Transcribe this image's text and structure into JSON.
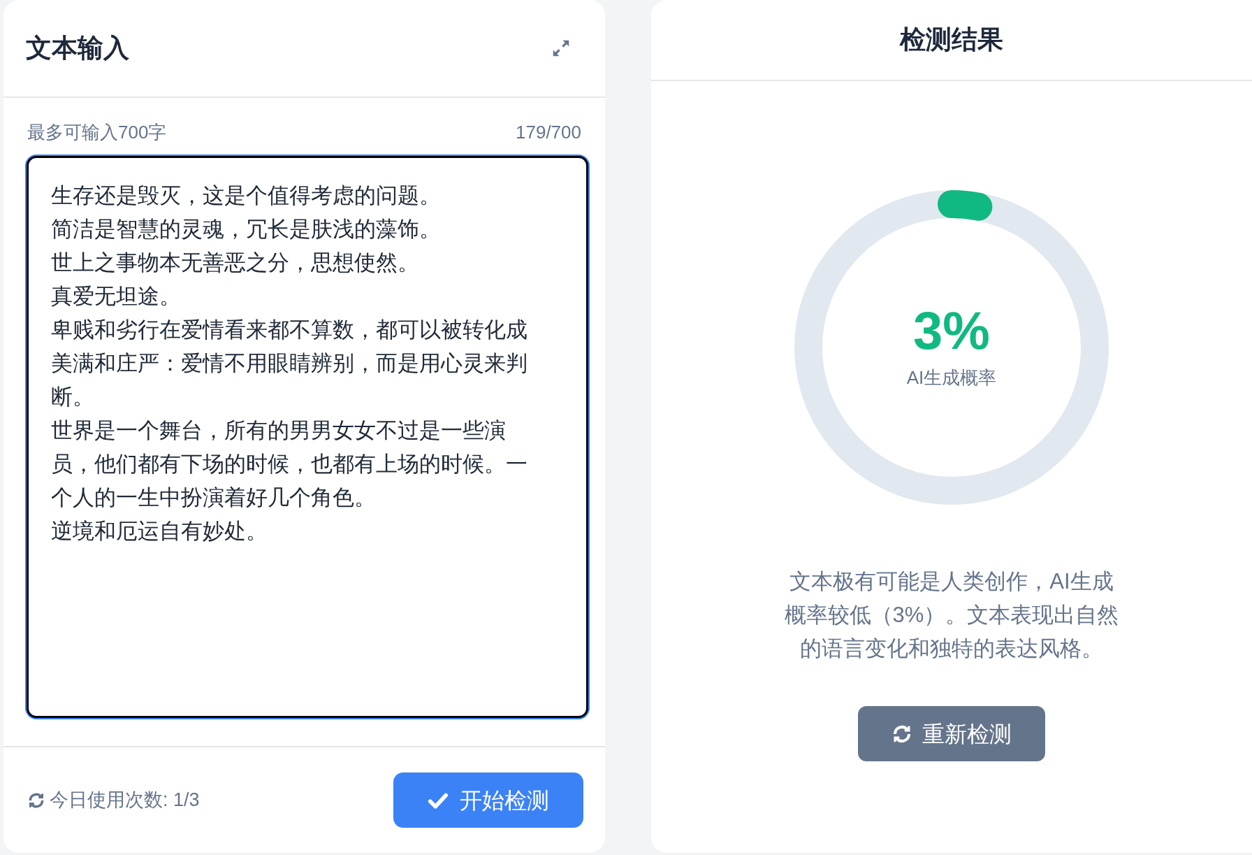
{
  "input_panel": {
    "title": "文本输入",
    "hint": "最多可输入700字",
    "counter": "179/700",
    "paragraphs": [
      "生存还是毁灭，这是个值得考虑的问题。",
      "简洁是智慧的灵魂，冗长是肤浅的藻饰。",
      "世上之事物本无善恶之分，思想使然。",
      "真爱无坦途。",
      "卑贱和劣行在爱情看来都不算数，都可以被转化成美满和庄严：爱情不用眼睛辨别，而是用心灵来判断。",
      "世界是一个舞台，所有的男男女女不过是一些演员，他们都有下场的时候，也都有上场的时候。一个人的一生中扮演着好几个角色。",
      "逆境和厄运自有妙处。"
    ],
    "usage": "今日使用次数: 1/3",
    "start_button": "开始检测"
  },
  "result_panel": {
    "title": "检测结果",
    "gauge": {
      "value": "3%",
      "label": "AI生成概率"
    },
    "description": "文本极有可能是人类创作，AI生成概率较低（3%）。文本表现出自然的语言变化和独特的表达风格。",
    "retry_button": "重新检测"
  }
}
